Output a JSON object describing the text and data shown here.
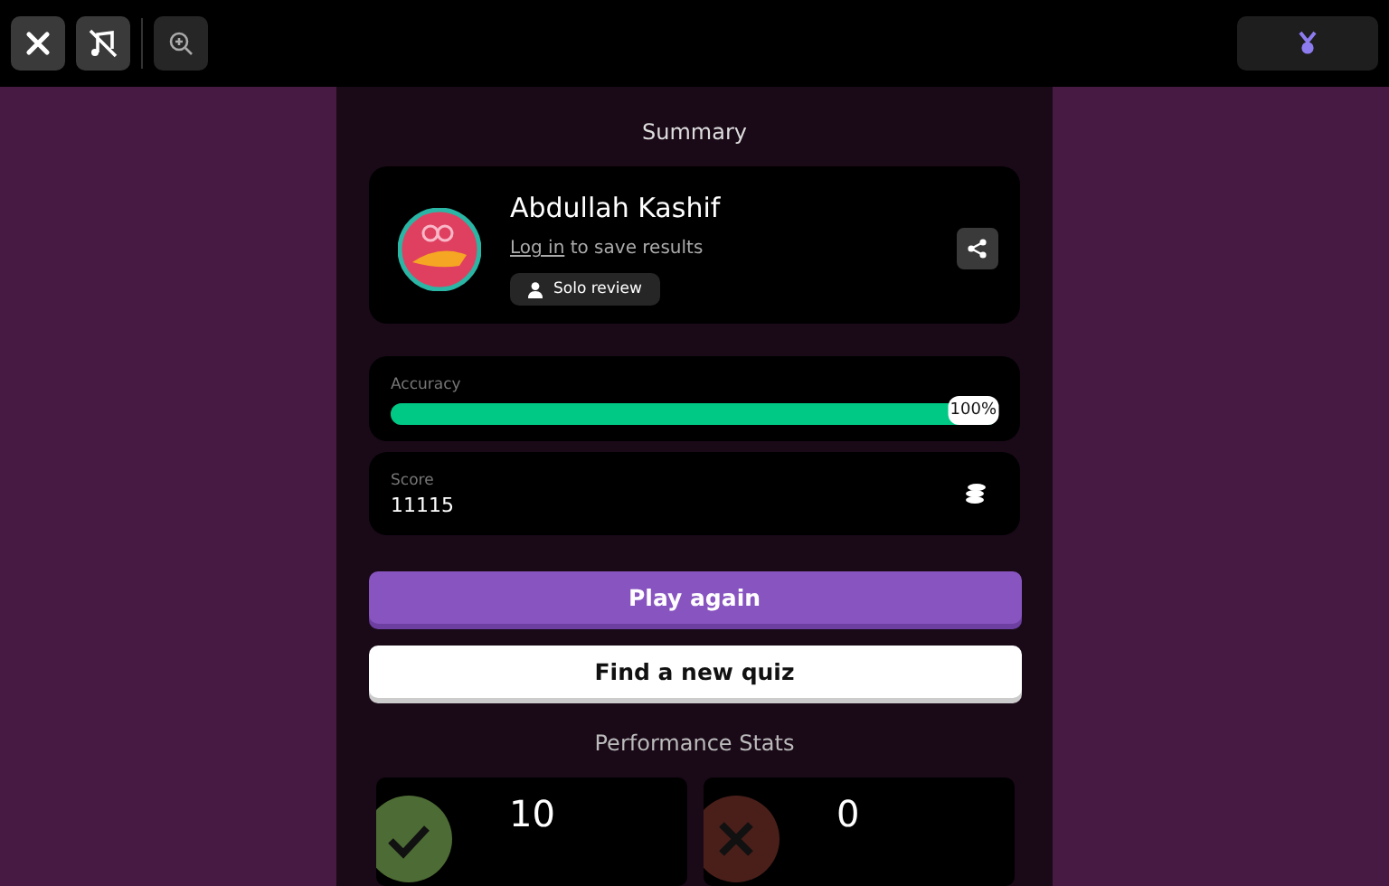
{
  "summary_title": "Summary",
  "player": {
    "name": "Abdullah Kashif",
    "login_link": "Log in",
    "login_text": "to save results",
    "badge": "Solo review"
  },
  "accuracy": {
    "label": "Accuracy",
    "level": 1,
    "reading": "100%"
  },
  "score": {
    "label": "Score",
    "value": "11115"
  },
  "buttons": [
    {
      "label": "Play again",
      "kind": "primary"
    },
    {
      "label": "Find a new quiz",
      "kind": "secondary"
    }
  ],
  "stats_title": "Performance Stats",
  "stats": [
    {
      "kind": "correct",
      "value": "10"
    },
    {
      "kind": "incorrect",
      "value": "0"
    }
  ]
}
